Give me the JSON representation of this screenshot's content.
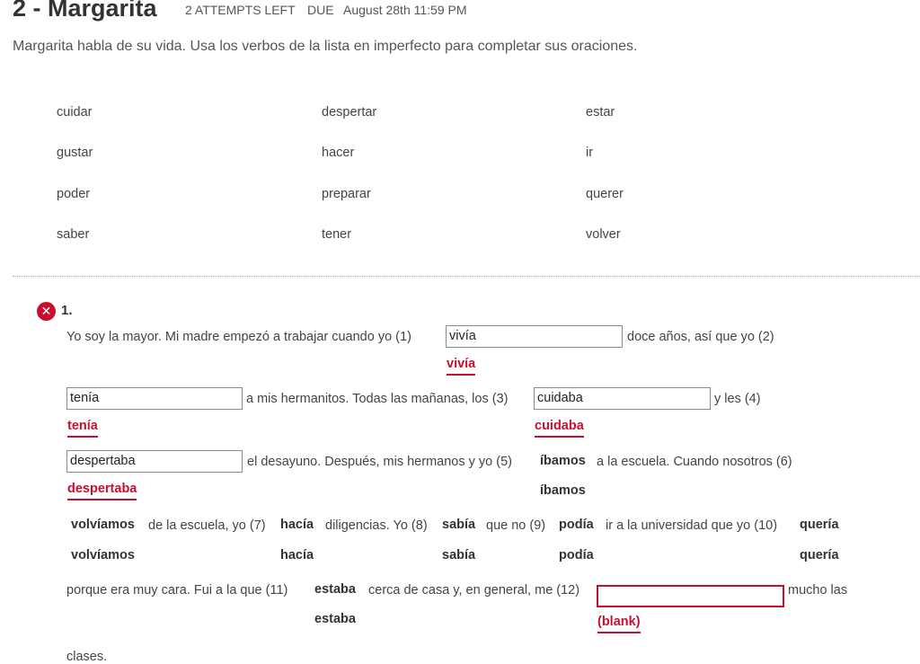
{
  "header": {
    "title": "2 - Margarita",
    "attempts": "2 ATTEMPTS LEFT",
    "due_label": "DUE",
    "due_date": "August 28th 11:59 PM"
  },
  "instructions": "Margarita habla de su vida. Usa los verbos de la lista en imperfecto para completar sus oraciones.",
  "verbs": [
    "cuidar",
    "despertar",
    "estar",
    "gustar",
    "hacer",
    "ir",
    "poder",
    "preparar",
    "querer",
    "saber",
    "tener",
    "volver"
  ],
  "question": {
    "number": "1.",
    "status_icon": "error-x-icon",
    "texts": {
      "t0": "Yo soy la mayor. Mi madre empezó a trabajar cuando yo (1)",
      "t1": "doce años, así que yo (2)",
      "t2": "a mis hermanitos. Todas las mañanas, los (3)",
      "t3": "y les (4)",
      "t4": "el desayuno. Después, mis hermanos y yo (5)",
      "t5": "a la escuela. Cuando nosotros (6)",
      "t6": "de la escuela, yo (7)",
      "t7": "diligencias. Yo (8)",
      "t8": "que no (9)",
      "t9": "ir a la universidad que yo (10)",
      "t10": "porque era muy cara. Fui a la que (11)",
      "t11": "cerca de casa y, en general, me (12)",
      "t12": "mucho las",
      "t13": "clases."
    },
    "blanks": [
      {
        "n": 1,
        "value": "vivía",
        "answer": "vivía"
      },
      {
        "n": 2,
        "value": "tenía",
        "answer": "tenía"
      },
      {
        "n": 3,
        "value": "cuidaba",
        "answer": "cuidaba"
      },
      {
        "n": 4,
        "value": "despertaba",
        "answer": "despertaba"
      },
      {
        "n": 5,
        "value": "íbamos",
        "answer": "íbamos"
      },
      {
        "n": 6,
        "value": "volvíamos",
        "answer": "volvíamos"
      },
      {
        "n": 7,
        "value": "hacía",
        "answer": "hacía"
      },
      {
        "n": 8,
        "value": "sabía",
        "answer": "sabía"
      },
      {
        "n": 9,
        "value": "podía",
        "answer": "podía"
      },
      {
        "n": 10,
        "value": "quería",
        "answer": "quería"
      },
      {
        "n": 11,
        "value": "estaba",
        "answer": "estaba"
      },
      {
        "n": 12,
        "value": "",
        "answer": "(blank)"
      }
    ]
  },
  "colors": {
    "error": "#c8102e",
    "text": "#444444"
  }
}
